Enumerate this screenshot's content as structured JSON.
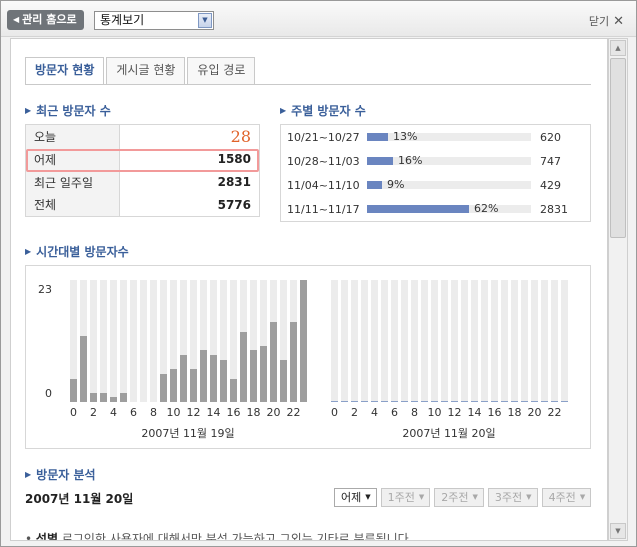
{
  "header": {
    "home_button": "관리 홈으로",
    "view_select": "통계보기",
    "close_label": "닫기"
  },
  "tabs": [
    {
      "label": "방문자 현황",
      "active": true
    },
    {
      "label": "게시글 현황",
      "active": false
    },
    {
      "label": "유입 경로",
      "active": false
    }
  ],
  "recent_visitors": {
    "title": "최근 방문자 수",
    "rows": [
      {
        "label": "오늘",
        "value": "28"
      },
      {
        "label": "어제",
        "value": "1580"
      },
      {
        "label": "최근 일주일",
        "value": "2831"
      },
      {
        "label": "전체",
        "value": "5776"
      }
    ]
  },
  "weekly_visitors": {
    "title": "주별 방문자 수",
    "rows": [
      {
        "range": "10/21~10/27",
        "pct": "13%",
        "fraction": 0.13,
        "count": "620"
      },
      {
        "range": "10/28~11/03",
        "pct": "16%",
        "fraction": 0.16,
        "count": "747"
      },
      {
        "range": "11/04~11/10",
        "pct": "9%",
        "fraction": 0.09,
        "count": "429"
      },
      {
        "range": "11/11~11/17",
        "pct": "62%",
        "fraction": 0.62,
        "count": "2831"
      }
    ]
  },
  "hourly": {
    "title": "시간대별 방문자수"
  },
  "chart_data": {
    "type": "bar",
    "ylim": [
      0,
      23
    ],
    "y_ticks": [
      "23",
      "0"
    ],
    "x_tick_labels": [
      "0",
      "2",
      "4",
      "6",
      "8",
      "10",
      "12",
      "14",
      "16",
      "18",
      "20",
      "22"
    ],
    "panels": [
      {
        "date_label": "2007년 11월 19일",
        "values": [
          5,
          14,
          2,
          2,
          1,
          2,
          0,
          0,
          0,
          6,
          7,
          10,
          7,
          11,
          10,
          9,
          5,
          15,
          11,
          12,
          17,
          9,
          17,
          26
        ]
      },
      {
        "date_label": "2007년 11월 20일",
        "values": [
          0,
          0,
          0,
          0,
          0,
          0,
          0,
          0,
          0,
          0,
          0,
          0,
          0,
          0,
          0,
          0,
          0,
          0,
          0,
          0,
          0,
          0,
          0,
          0
        ]
      }
    ],
    "colors": {
      "bar": "#9e9e9e",
      "track": "#ececec"
    }
  },
  "analysis": {
    "title": "방문자 분석",
    "date": "2007년 11월 20일",
    "buttons": [
      {
        "label": "어제",
        "enabled": true
      },
      {
        "label": "1주전",
        "enabled": false
      },
      {
        "label": "2주전",
        "enabled": false
      },
      {
        "label": "3주전",
        "enabled": false
      },
      {
        "label": "4주전",
        "enabled": false
      }
    ],
    "note_bold": "성별",
    "note_text": "로그인한 사용자에 대해서만 분석 가능하고 그외는 기타로 분류됩니다."
  },
  "colors": {
    "accent": "#3a5f9a",
    "today": "#e0632a",
    "bar": "#6a85c0"
  }
}
